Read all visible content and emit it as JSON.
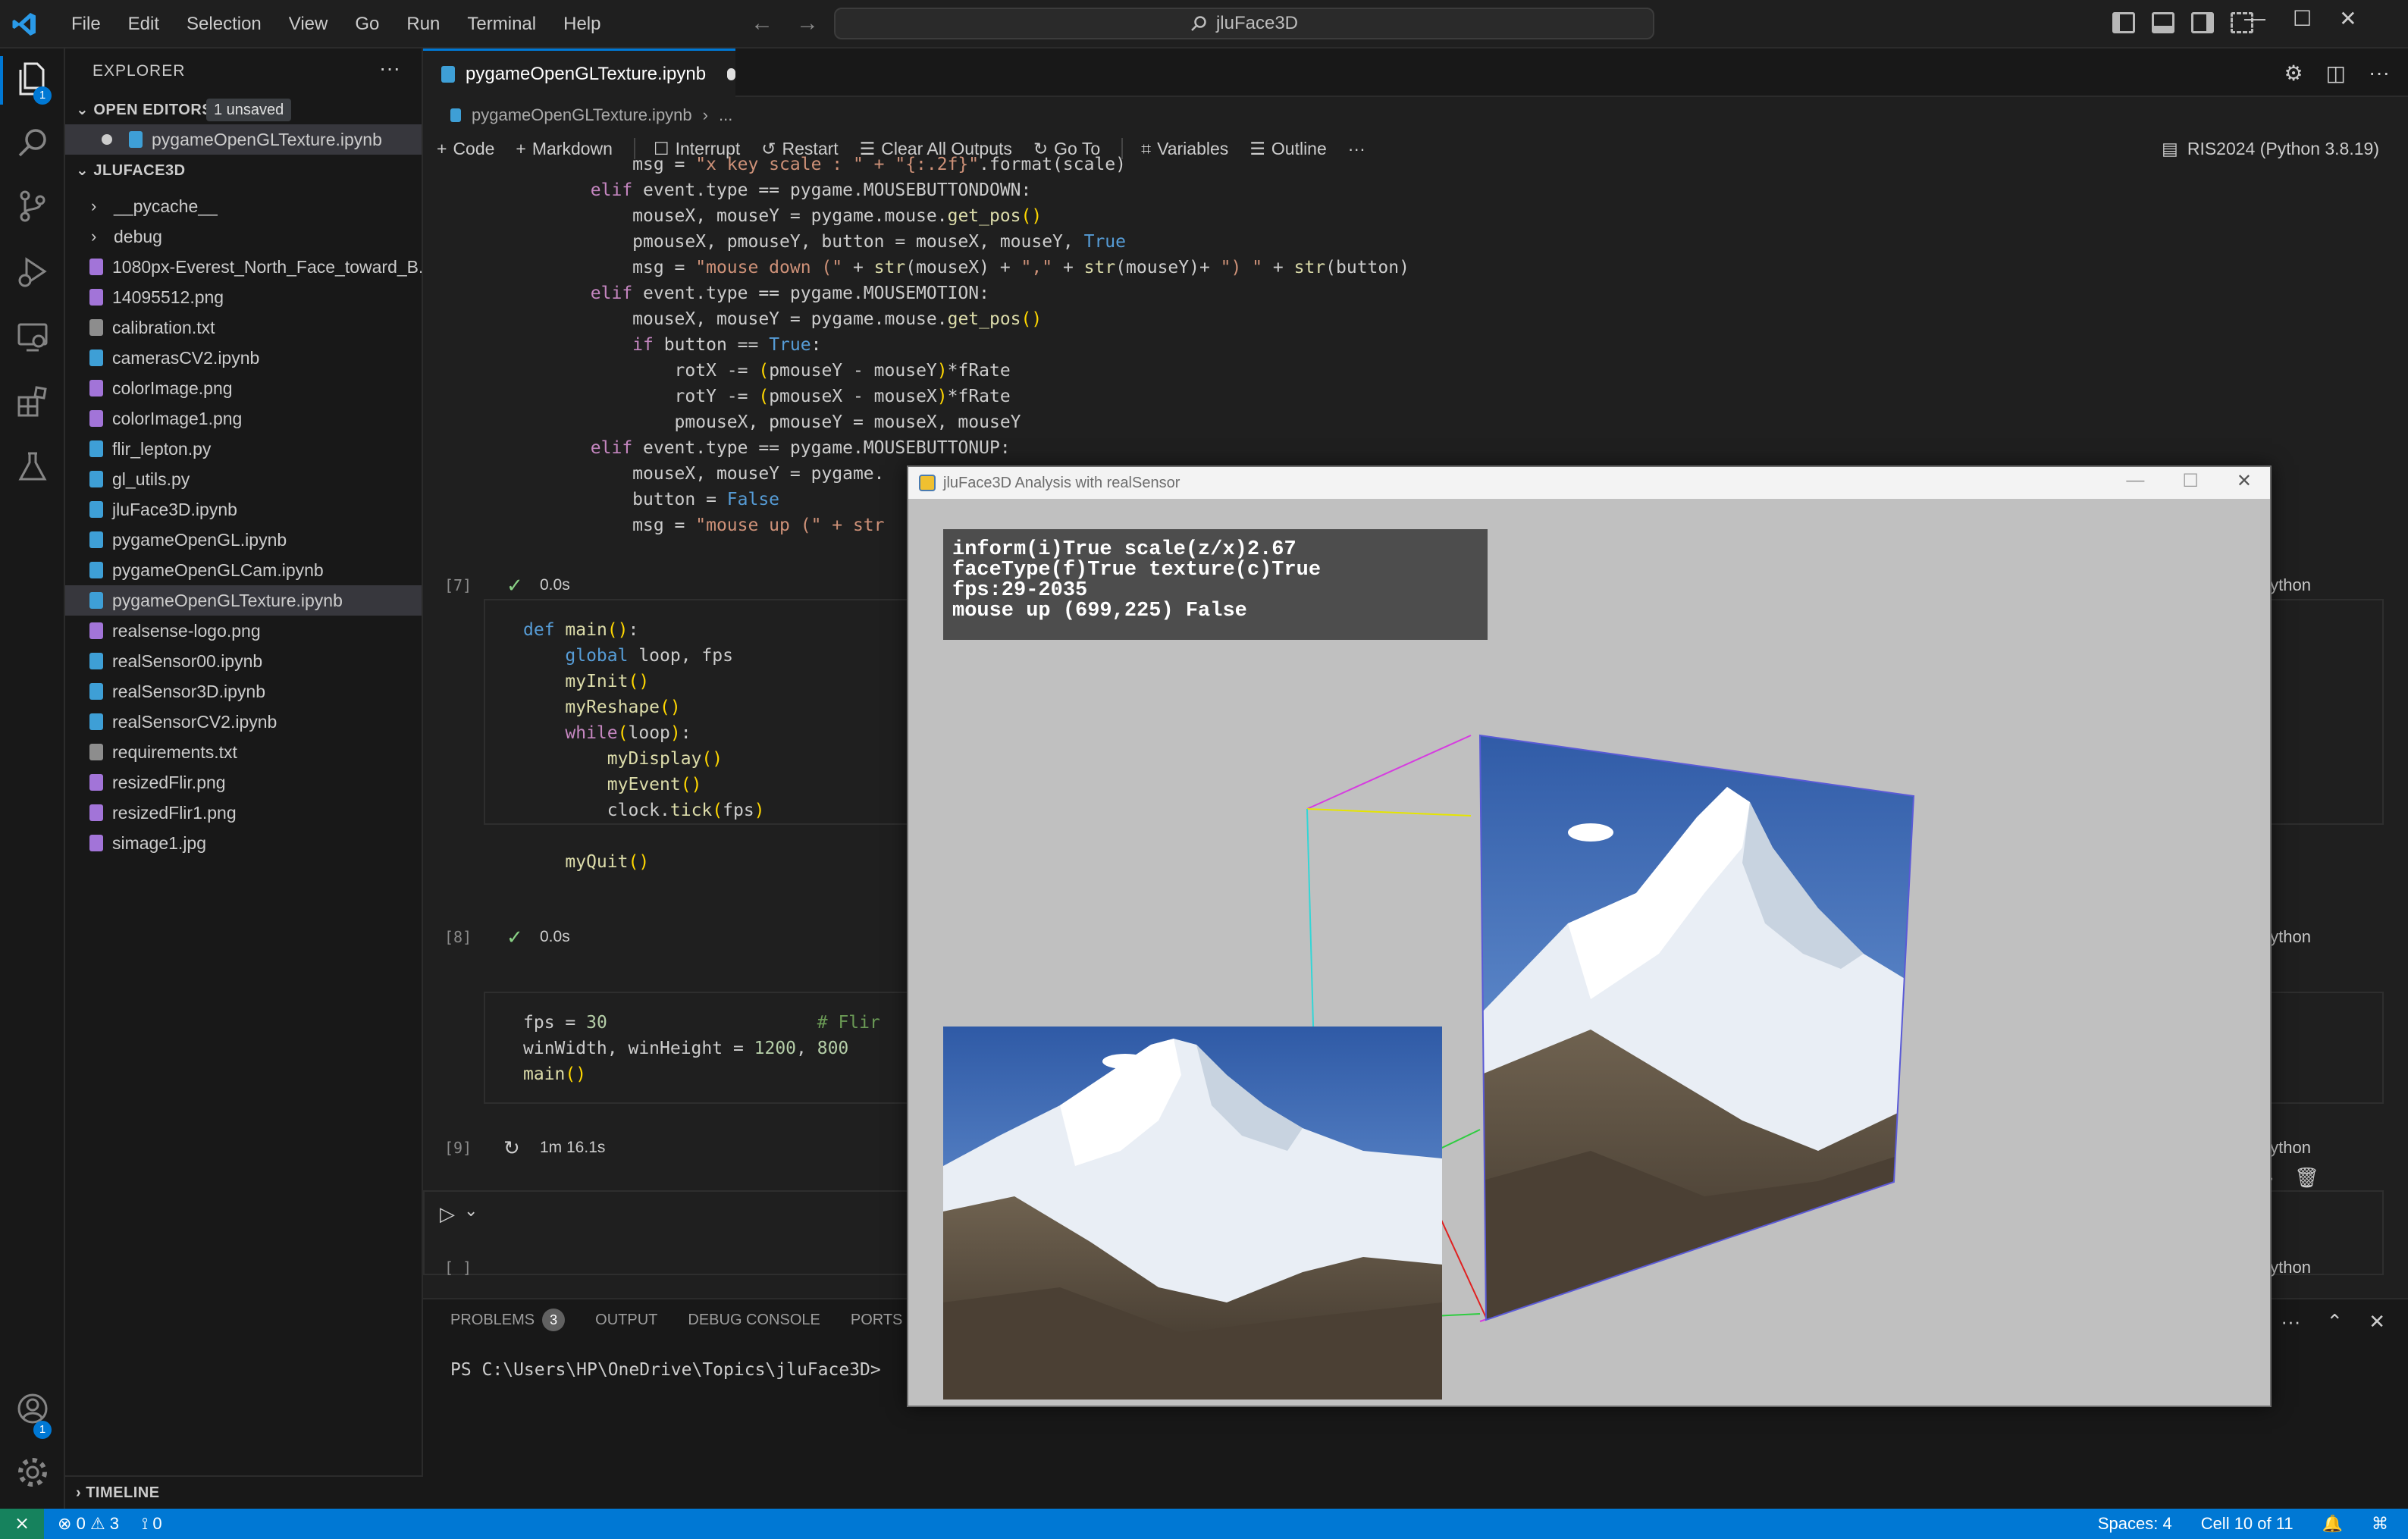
{
  "titlebar": {
    "menu": [
      "File",
      "Edit",
      "Selection",
      "View",
      "Go",
      "Run",
      "Terminal",
      "Help"
    ],
    "search": "jluFace3D"
  },
  "activity": {
    "explorer_badge": "1",
    "accounts_badge": "1"
  },
  "sidebar": {
    "header": "EXPLORER",
    "open_editors_title": "OPEN EDITORS",
    "unsaved_badge": "1 unsaved",
    "open_editor_file": "pygameOpenGLTexture.ipynb",
    "folder_title": "JLUFACE3D",
    "items": [
      {
        "label": "__pycache__",
        "kind": "folder"
      },
      {
        "label": "debug",
        "kind": "folder"
      },
      {
        "label": "1080px-Everest_North_Face_toward_B...",
        "kind": "image"
      },
      {
        "label": "14095512.png",
        "kind": "image"
      },
      {
        "label": "calibration.txt",
        "kind": "text"
      },
      {
        "label": "camerasCV2.ipynb",
        "kind": "notebook"
      },
      {
        "label": "colorImage.png",
        "kind": "image"
      },
      {
        "label": "colorImage1.png",
        "kind": "image"
      },
      {
        "label": "flir_lepton.py",
        "kind": "python"
      },
      {
        "label": "gl_utils.py",
        "kind": "python"
      },
      {
        "label": "jluFace3D.ipynb",
        "kind": "notebook"
      },
      {
        "label": "pygameOpenGL.ipynb",
        "kind": "notebook"
      },
      {
        "label": "pygameOpenGLCam.ipynb",
        "kind": "notebook"
      },
      {
        "label": "pygameOpenGLTexture.ipynb",
        "kind": "notebook",
        "selected": true
      },
      {
        "label": "realsense-logo.png",
        "kind": "image"
      },
      {
        "label": "realSensor00.ipynb",
        "kind": "notebook"
      },
      {
        "label": "realSensor3D.ipynb",
        "kind": "notebook"
      },
      {
        "label": "realSensorCV2.ipynb",
        "kind": "notebook"
      },
      {
        "label": "requirements.txt",
        "kind": "text"
      },
      {
        "label": "resizedFlir.png",
        "kind": "image"
      },
      {
        "label": "resizedFlir1.png",
        "kind": "image"
      },
      {
        "label": "simage1.jpg",
        "kind": "image"
      }
    ],
    "timeline_title": "TIMELINE"
  },
  "editor": {
    "tab_label": "pygameOpenGLTexture.ipynb",
    "breadcrumb": [
      "pygameOpenGLTexture.ipynb",
      "..."
    ],
    "toolbar": {
      "code": "Code",
      "markdown": "Markdown",
      "interrupt": "Interrupt",
      "restart": "Restart",
      "clear": "Clear All Outputs",
      "goto": "Go To",
      "variables": "Variables",
      "outline": "Outline",
      "more": "···"
    },
    "kernel": "RIS2024 (Python 3.8.19)",
    "cells": [
      {
        "exec": "[7]",
        "time": "0.0s",
        "lang": "Python"
      },
      {
        "exec": "[8]",
        "time": "0.0s",
        "lang": "Python"
      },
      {
        "exec": "[9]",
        "time": "1m 16.1s",
        "lang": "Python"
      },
      {
        "exec": "[ ]",
        "lang": "Python"
      }
    ]
  },
  "panel": {
    "tabs": [
      "PROBLEMS",
      "OUTPUT",
      "DEBUG CONSOLE",
      "PORTS"
    ],
    "problems_count": "3",
    "terminal_prompt": "PS C:\\Users\\HP\\OneDrive\\Topics\\jluFace3D>"
  },
  "statusbar": {
    "errors": "0",
    "warnings": "3",
    "ports": "0",
    "spaces": "Spaces: 4",
    "cell": "Cell 10 of 11"
  },
  "pygame": {
    "title": "jluFace3D Analysis with realSensor",
    "info": [
      "inform(i)True scale(z/x)2.67",
      "faceType(f)True texture(c)True",
      "fps:29-2035",
      "mouse up (699,225) False"
    ]
  },
  "colors": {
    "accent": "#0078d4",
    "statusbar": "#0078d4",
    "remote": "#16825d"
  }
}
